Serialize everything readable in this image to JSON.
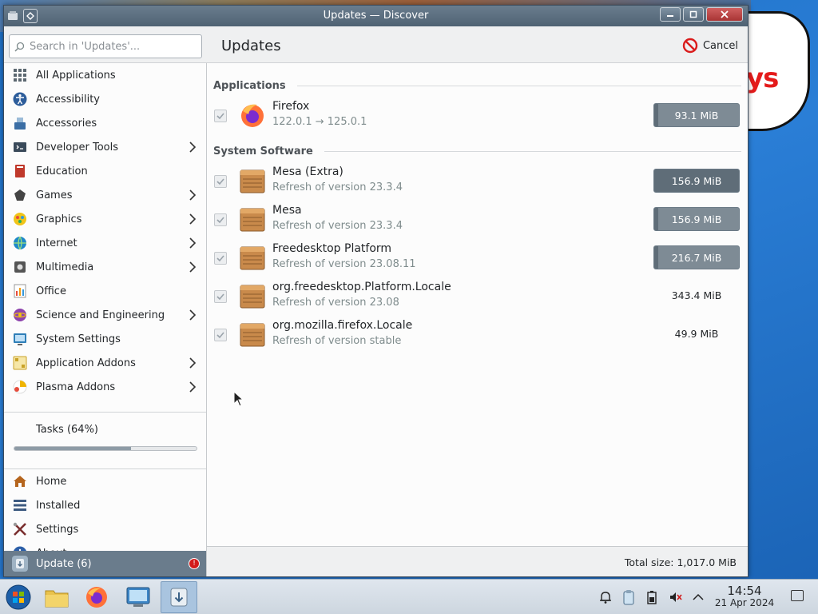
{
  "window": {
    "title": "Updates — Discover"
  },
  "desktop": {
    "bubble_text": "ys"
  },
  "sidebar": {
    "search_placeholder": "Search in 'Updates'...",
    "categories": [
      {
        "label": "All Applications",
        "icon": "grid-icon",
        "color": "#5b6770",
        "submenu": false
      },
      {
        "label": "Accessibility",
        "icon": "accessibility-icon",
        "color": "#2d5d9b",
        "submenu": false
      },
      {
        "label": "Accessories",
        "icon": "accessories-icon",
        "color": "#3b6ea5",
        "submenu": false
      },
      {
        "label": "Developer Tools",
        "icon": "developer-tools-icon",
        "color": "#3a4a5a",
        "submenu": true
      },
      {
        "label": "Education",
        "icon": "education-icon",
        "color": "#c0392b",
        "submenu": false
      },
      {
        "label": "Games",
        "icon": "games-icon",
        "color": "#444444",
        "submenu": true
      },
      {
        "label": "Graphics",
        "icon": "graphics-icon",
        "color": "#d35400",
        "submenu": true
      },
      {
        "label": "Internet",
        "icon": "internet-icon",
        "color": "#1e88c8",
        "submenu": true
      },
      {
        "label": "Multimedia",
        "icon": "multimedia-icon",
        "color": "#555555",
        "submenu": true
      },
      {
        "label": "Office",
        "icon": "office-icon",
        "color": "#e67e22",
        "submenu": false
      },
      {
        "label": "Science and Engineering",
        "icon": "science-icon",
        "color": "#8e44ad",
        "submenu": true
      },
      {
        "label": "System Settings",
        "icon": "system-settings-icon",
        "color": "#2f7fb8",
        "submenu": false
      },
      {
        "label": "Application Addons",
        "icon": "application-addons-icon",
        "color": "#c9a227",
        "submenu": true
      },
      {
        "label": "Plasma Addons",
        "icon": "plasma-addons-icon",
        "color": "#f0b400",
        "submenu": true
      }
    ],
    "tasks": {
      "label": "Tasks (64%)",
      "progress": 0.64
    },
    "bottom": [
      {
        "label": "Home",
        "icon": "home-icon",
        "color": "#b5651d"
      },
      {
        "label": "Installed",
        "icon": "installed-list-icon",
        "color": "#3d5a80"
      },
      {
        "label": "Settings",
        "icon": "settings-icon",
        "color": "#7a2e2e"
      },
      {
        "label": "About",
        "icon": "about-icon",
        "color": "#2c5fa8"
      }
    ],
    "update": {
      "label": "Update (6)",
      "icon": "update-icon"
    }
  },
  "main": {
    "title": "Updates",
    "cancel_label": "Cancel",
    "sections": [
      {
        "title": "Applications"
      },
      {
        "title": "System Software"
      }
    ],
    "packages": [
      {
        "name": "Firefox",
        "sub": "122.0.1 → 125.0.1",
        "size": "93.1 MiB",
        "progress": 0.05,
        "icon": "firefox-icon",
        "section": 0
      },
      {
        "name": "Mesa (Extra)",
        "sub": "Refresh of version 23.3.4",
        "size": "156.9 MiB",
        "progress": 1.0,
        "icon": "package-icon",
        "section": 1
      },
      {
        "name": "Mesa",
        "sub": "Refresh of version 23.3.4",
        "size": "156.9 MiB",
        "progress": 0.05,
        "icon": "package-icon",
        "section": 1
      },
      {
        "name": "Freedesktop Platform",
        "sub": "Refresh of version 23.08.11",
        "size": "216.7 MiB",
        "progress": 0.05,
        "icon": "package-icon",
        "section": 1
      },
      {
        "name": "org.freedesktop.Platform.Locale",
        "sub": "Refresh of version 23.08",
        "size": "343.4 MiB",
        "progress": null,
        "icon": "package-icon",
        "section": 1
      },
      {
        "name": "org.mozilla.firefox.Locale",
        "sub": "Refresh of version stable",
        "size": "49.9 MiB",
        "progress": null,
        "icon": "package-icon",
        "section": 1
      }
    ],
    "total": "Total size: 1,017.0 MiB"
  },
  "taskbar": {
    "time": "14:54",
    "date": "21 Apr 2024",
    "apps": [
      "start-orb-icon",
      "file-manager-icon",
      "firefox-icon",
      "system-settings-icon",
      "discover-icon"
    ],
    "tray": [
      "notifications-icon",
      "clipboard-icon",
      "battery-icon",
      "volume-muted-icon",
      "tray-expand-icon"
    ]
  }
}
